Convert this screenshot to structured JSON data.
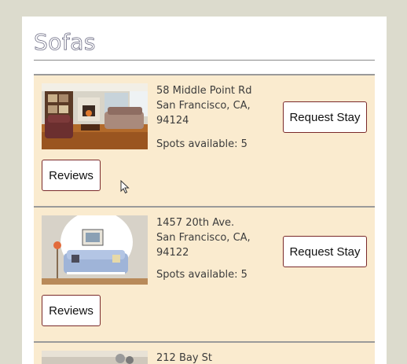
{
  "page": {
    "title": "Sofas"
  },
  "listings": [
    {
      "address_line1": "58 Middle Point Rd",
      "address_line2": "San Francisco, CA,",
      "zip": "94124",
      "spots": "Spots available: 5",
      "request_label": "Request Stay",
      "reviews_label": "Reviews"
    },
    {
      "address_line1": "1457 20th Ave.",
      "address_line2": "San Francisco, CA,",
      "zip": "94122",
      "spots": "Spots available: 5",
      "request_label": "Request Stay",
      "reviews_label": "Reviews"
    },
    {
      "address_line1": "212 Bay St"
    }
  ],
  "icons": {
    "cursor": "mouse-pointer-icon"
  },
  "colors": {
    "background": "#dcdbcd",
    "card": "#faebcf",
    "button_border": "#7a2a2a"
  }
}
